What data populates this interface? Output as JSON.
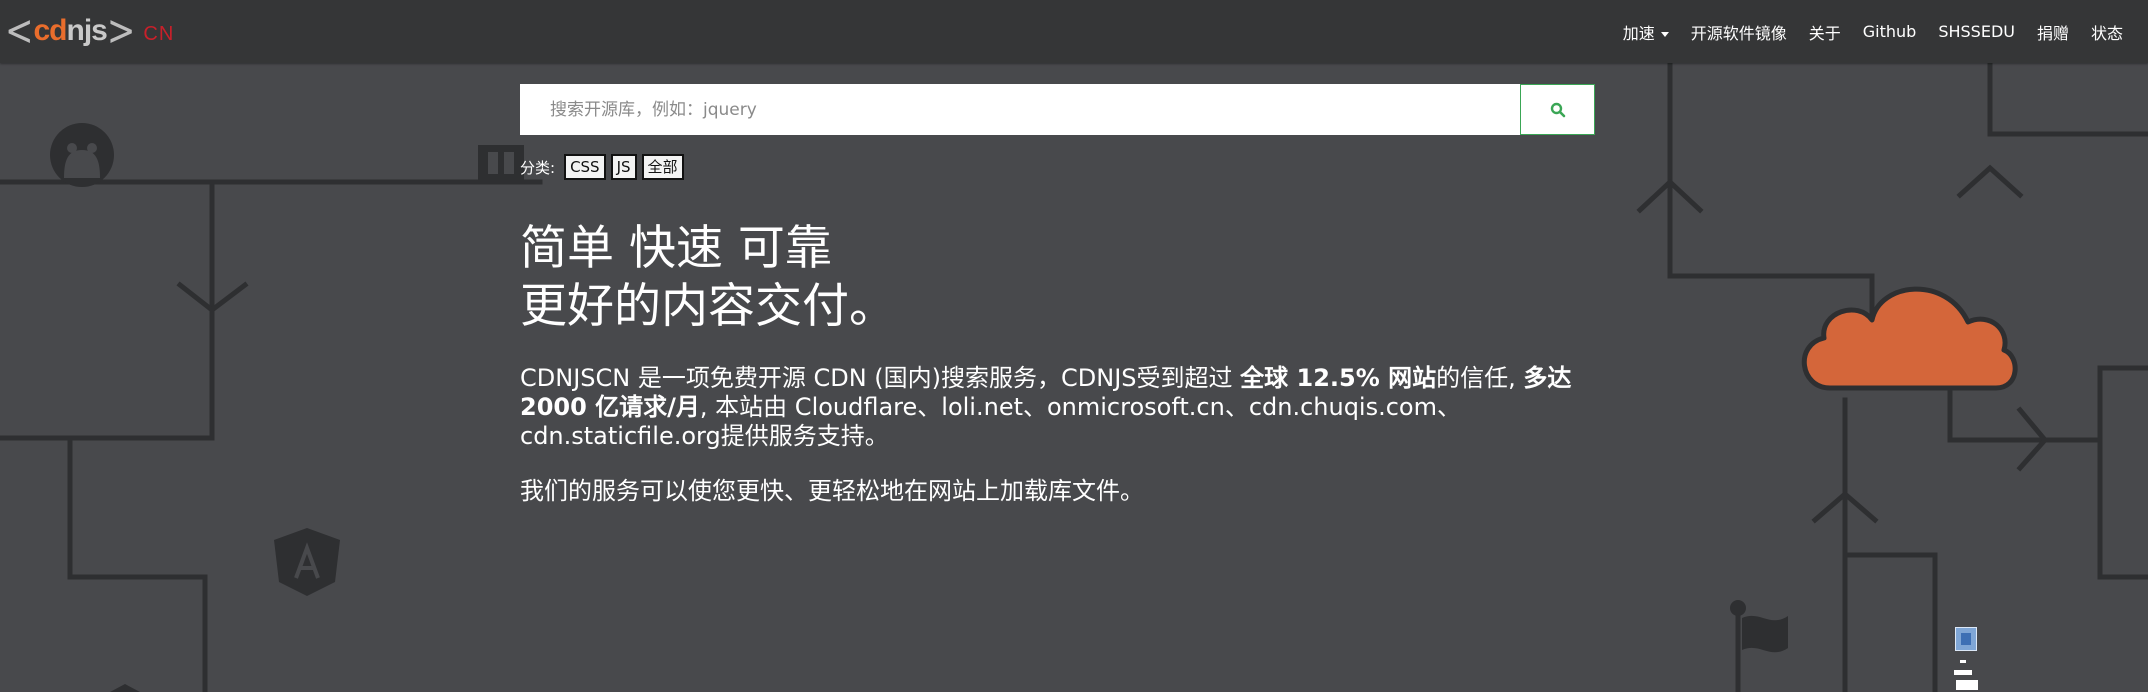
{
  "brand": {
    "left_chevron": "<",
    "cd": "cd",
    "nj": "njs",
    "right_chevron": ">",
    "suffix": "CN"
  },
  "nav": {
    "items": [
      {
        "label": "加速",
        "has_dropdown": true
      },
      {
        "label": "开源软件镜像"
      },
      {
        "label": "关于"
      },
      {
        "label": "Github"
      },
      {
        "label": "SHSSEDU"
      },
      {
        "label": "捐赠"
      },
      {
        "label": "状态"
      }
    ]
  },
  "search": {
    "placeholder": "搜索开源库，例如：jquery",
    "value": "",
    "button_icon": "search-icon"
  },
  "filters": {
    "label": "分类:",
    "options": [
      "CSS",
      "JS",
      "全部"
    ]
  },
  "hero": {
    "title_line1": "简单 快速 可靠",
    "title_line2": "更好的内容交付。",
    "desc_part1": "CDNJSCN 是一项免费开源 CDN (国内)搜索服务，CDNJS受到超过 ",
    "desc_bold1": "全球 12.5% 网站",
    "desc_part2": "的信任, ",
    "desc_bold2": "多达 2000 亿请求/月",
    "desc_part3": ", 本站由 Cloudflare、loli.net、onmicrosoft.cn、cdn.chuqis.com、cdn.staticfile.org提供服务支持。",
    "sub": "我们的服务可以使您更快、更轻松地在网站上加载库文件。"
  },
  "colors": {
    "background": "#48494c",
    "navbar": "#353637",
    "accent_green": "#3aa655",
    "cloud_orange": "#d4663a",
    "brand_orange": "#e96d2c",
    "brand_red": "#c8202a",
    "line_dark": "#2e2f31"
  }
}
